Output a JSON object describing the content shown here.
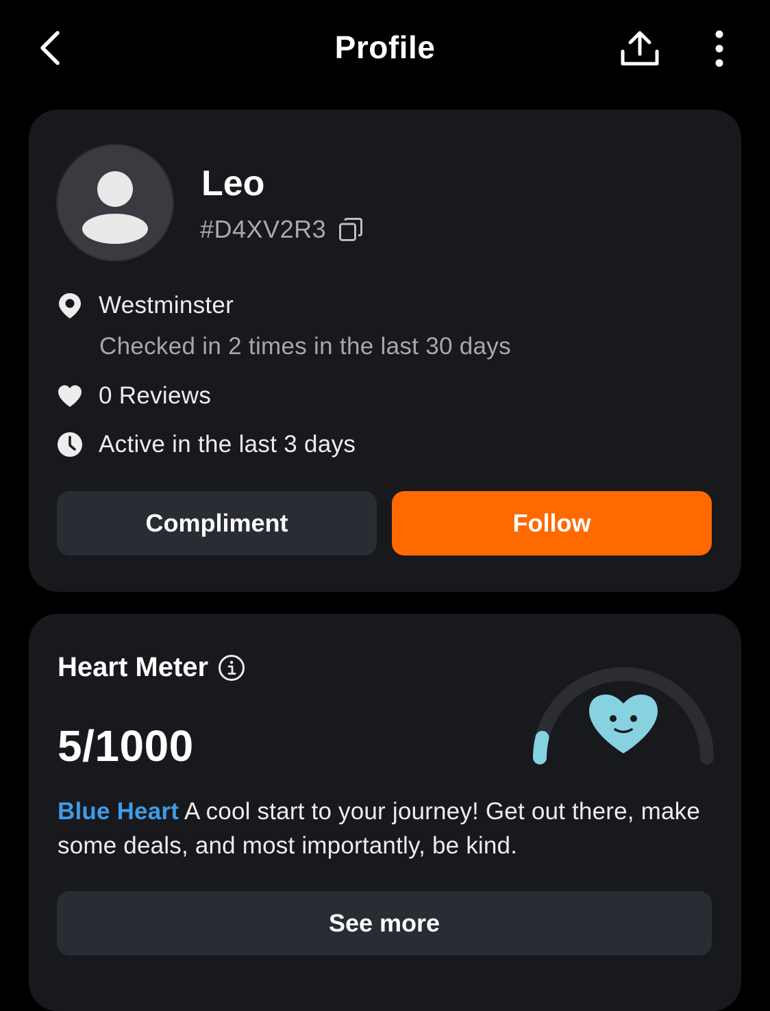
{
  "header": {
    "title": "Profile",
    "back_icon": "chevron-left-icon",
    "share_icon": "share-upload-icon",
    "more_icon": "more-vertical-icon"
  },
  "profile": {
    "name": "Leo",
    "user_id": "#D4XV2R3",
    "avatar_icon": "default-avatar-icon",
    "location": "Westminster",
    "checkins": "Checked in 2 times in the last 30 days",
    "reviews": "0 Reviews",
    "activity": "Active in the last 3 days",
    "compliment_label": "Compliment",
    "follow_label": "Follow"
  },
  "heart_meter": {
    "title": "Heart Meter",
    "score": "5/1000",
    "progress": 0.005,
    "level": "Blue Heart",
    "description": " A cool start to your journey! Get out there, make some deals, and most importantly, be kind.",
    "see_more_label": "See more"
  },
  "colors": {
    "background": "#000000",
    "card": "#18191d",
    "button_secondary": "#2a2c33",
    "accent_orange": "#ff6a00",
    "level_blue": "#3f9be8",
    "heart_blue": "#86d2e0",
    "gauge_track": "#2b2d33"
  }
}
